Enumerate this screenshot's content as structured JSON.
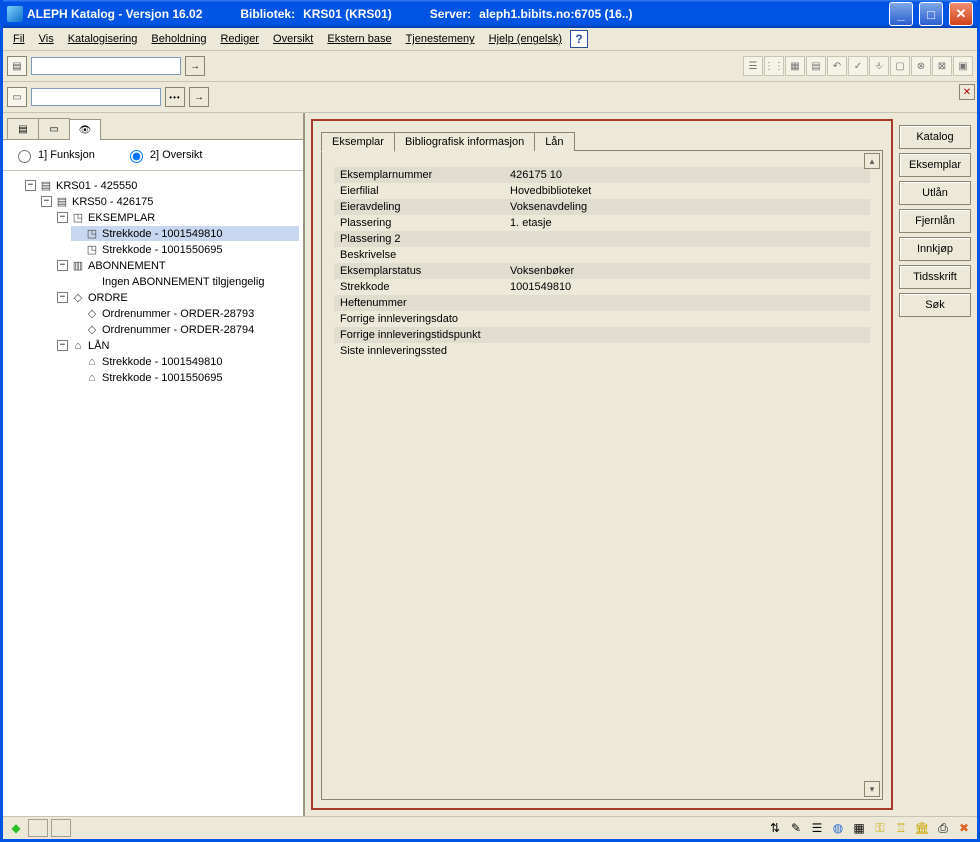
{
  "title": {
    "app": "ALEPH Katalog - Versjon 16.02",
    "library_label": "Bibliotek:",
    "library_value": "KRS01 (KRS01)",
    "server_label": "Server:",
    "server_value": "aleph1.bibits.no:6705 (16..)"
  },
  "menu": [
    "Fil",
    "Vis",
    "Katalogisering",
    "Beholdning",
    "Rediger",
    "Oversikt",
    "Ekstern base",
    "Tjenestemeny",
    "Hjelp (engelsk)"
  ],
  "radio": {
    "opt1": "1] Funksjon",
    "opt2": "2] Oversikt"
  },
  "tree": {
    "root": "KRS01 - 425550",
    "n1": "KRS50 - 426175",
    "n2": "EKSEMPLAR",
    "n2a": "Strekkode - 1001549810",
    "n2b": "Strekkode - 1001550695",
    "n3": "ABONNEMENT",
    "n3a": "Ingen ABONNEMENT tilgjengelig",
    "n4": "ORDRE",
    "n4a": "Ordrenummer - ORDER-28793",
    "n4b": "Ordrenummer - ORDER-28794",
    "n5": "LÅN",
    "n5a": "Strekkode - 1001549810",
    "n5b": "Strekkode - 1001550695"
  },
  "tabs": {
    "t1": "Eksemplar",
    "t2": "Bibliografisk informasjon",
    "t3": "Lån"
  },
  "detail": {
    "rows": [
      {
        "label": "Eksemplarnummer",
        "value": "426175 10"
      },
      {
        "label": "Eierfilial",
        "value": "Hovedbiblioteket"
      },
      {
        "label": "Eieravdeling",
        "value": "Voksenavdeling"
      },
      {
        "label": "Plassering",
        "value": "1. etasje"
      },
      {
        "label": "Plassering 2",
        "value": ""
      },
      {
        "label": "Beskrivelse",
        "value": ""
      },
      {
        "label": "Eksemplarstatus",
        "value": "Voksenbøker"
      },
      {
        "label": "Strekkode",
        "value": "1001549810"
      },
      {
        "label": "Heftenummer",
        "value": ""
      },
      {
        "label": "Forrige innleveringsdato",
        "value": ""
      },
      {
        "label": "Forrige innleveringstidspunkt",
        "value": ""
      },
      {
        "label": "Siste innleveringssted",
        "value": ""
      }
    ]
  },
  "sideButtons": [
    "Katalog",
    "Eksemplar",
    "Utlån",
    "Fjernlån",
    "Innkjøp",
    "Tidsskrift",
    "Søk"
  ]
}
